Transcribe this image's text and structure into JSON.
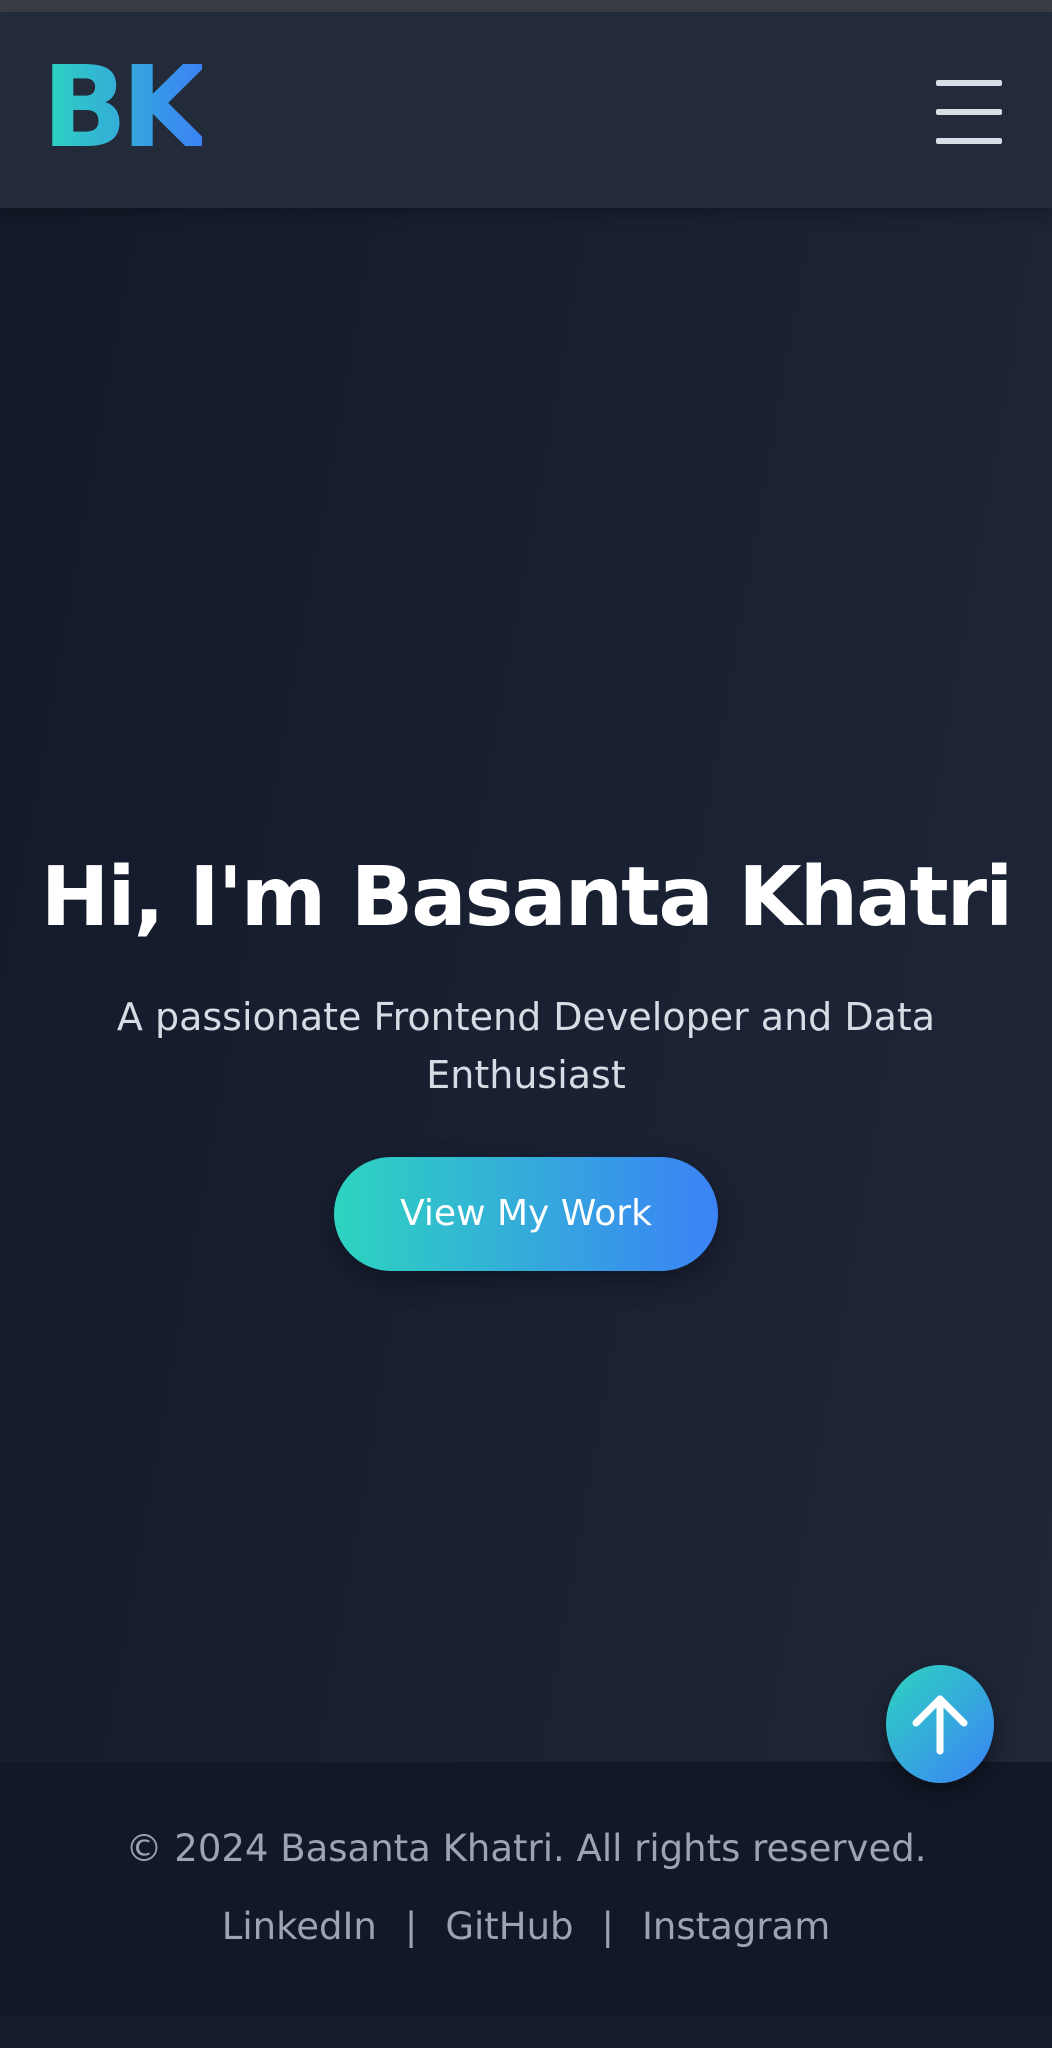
{
  "header": {
    "logo": "BK",
    "menu_icon": "hamburger-menu-icon"
  },
  "hero": {
    "title": "Hi, I'm Basanta Khatri",
    "subtitle": "A passionate Frontend Developer and Data Enthusiast",
    "cta_label": "View My Work"
  },
  "footer": {
    "copyright": "© 2024 Basanta Khatri. All rights reserved.",
    "links": [
      {
        "label": "LinkedIn"
      },
      {
        "label": "GitHub"
      },
      {
        "label": "Instagram"
      }
    ],
    "separator": "|"
  },
  "scroll_top": {
    "icon": "arrow-up-icon"
  },
  "colors": {
    "accent_start": "#2dd4bf",
    "accent_end": "#3b82f6",
    "background": "#151b2b",
    "header_background": "#232a39",
    "footer_background": "#111827",
    "text_primary": "#ffffff",
    "text_muted": "#9ca3b4"
  }
}
